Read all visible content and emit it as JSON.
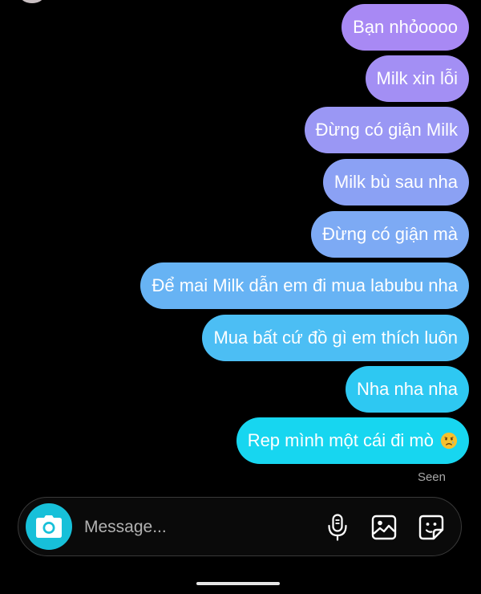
{
  "conversation": {
    "messages": [
      {
        "text": "Bạn nhỏoooo",
        "color": "#a889f4"
      },
      {
        "text": "Milk xin lỗi",
        "color": "#a38ff4"
      },
      {
        "text": "Đừng có giận Milk",
        "color": "#9a97f4"
      },
      {
        "text": "Milk bù sau nha",
        "color": "#8ba1f4"
      },
      {
        "text": "Đừng có giận mà",
        "color": "#7daaf4"
      },
      {
        "text": "Để mai Milk dẫn em đi mua labubu nha",
        "color": "#67b3f4"
      },
      {
        "text": "Mua bất cứ đồ gì em thích luôn",
        "color": "#4cbef4"
      },
      {
        "text": "Nha nha nha",
        "color": "#2ec8f2"
      },
      {
        "text": "Rep mình một cái đi mò",
        "emoji": "crying-face-icon",
        "color": "#17d6f0"
      }
    ],
    "seen_label": "Seen"
  },
  "composer": {
    "placeholder": "Message...",
    "camera_color": "#17c0d9",
    "camera_icon": "camera-icon",
    "mic_icon": "microphone-icon",
    "gallery_icon": "image-gallery-icon",
    "sticker_icon": "sticker-icon"
  }
}
